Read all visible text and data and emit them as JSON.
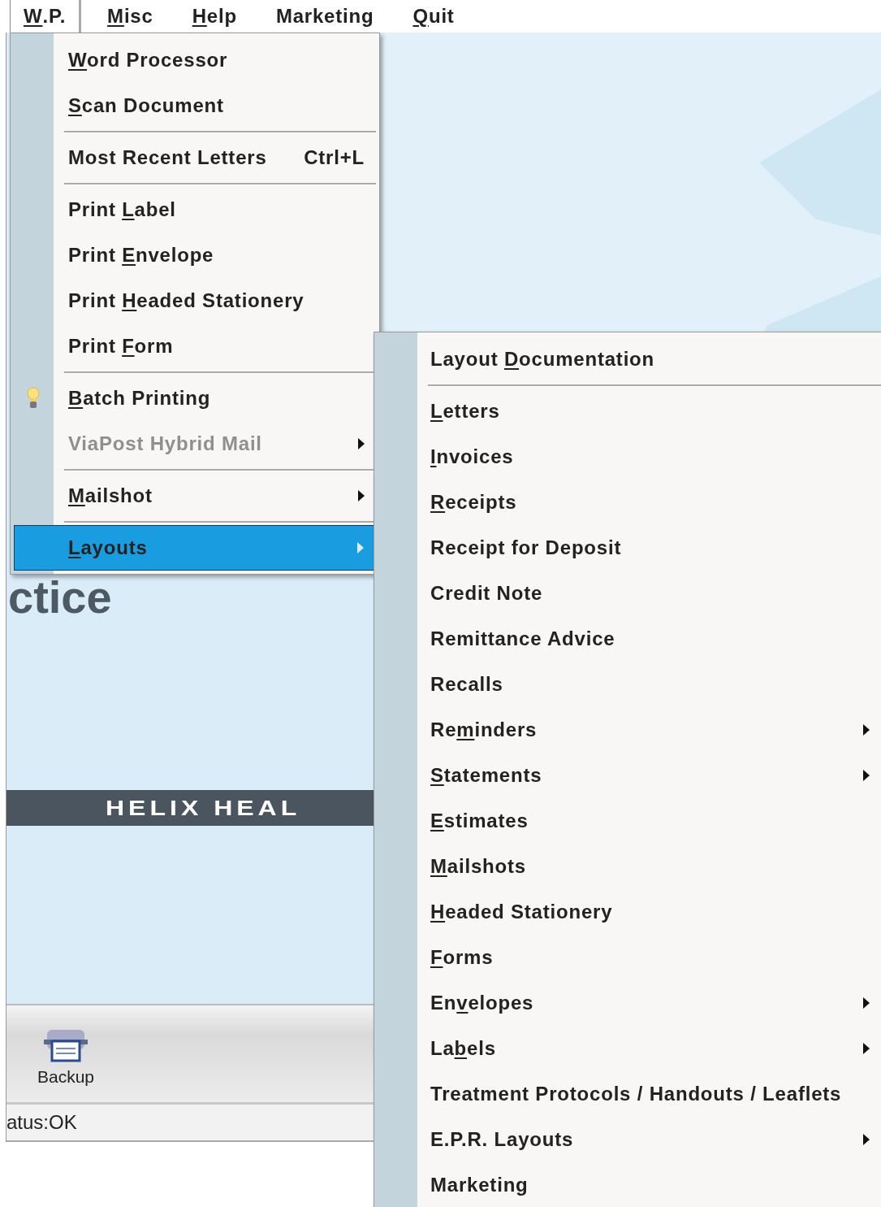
{
  "menubar": [
    {
      "key": "W",
      "after": ".P.",
      "selected": true
    },
    {
      "key": "M",
      "after": "isc",
      "selected": false
    },
    {
      "key": "H",
      "after": "elp",
      "selected": false
    },
    {
      "text": "Marketing",
      "selected": false
    },
    {
      "key": "Q",
      "after": "uit",
      "selected": false
    }
  ],
  "menu": [
    {
      "kind": "command",
      "key": "W",
      "after": "ord Processor",
      "selected": false,
      "disabled": false
    },
    {
      "kind": "command",
      "key": "S",
      "after": "can Document",
      "selected": false,
      "disabled": false
    },
    {
      "kind": "separator"
    },
    {
      "kind": "command",
      "text": "Most Recent Letters",
      "shortcut": "Ctrl+L",
      "selected": false,
      "disabled": false
    },
    {
      "kind": "separator"
    },
    {
      "kind": "command",
      "before": "Print ",
      "key": "L",
      "after": "abel",
      "selected": false,
      "disabled": false
    },
    {
      "kind": "command",
      "before": "Print ",
      "key": "E",
      "after": "nvelope",
      "selected": false,
      "disabled": false
    },
    {
      "kind": "command",
      "before": "Print ",
      "key": "H",
      "after": "eaded Stationery",
      "selected": false,
      "disabled": false
    },
    {
      "kind": "command",
      "before": "Print ",
      "key": "F",
      "after": "orm",
      "selected": false,
      "disabled": false
    },
    {
      "kind": "separator"
    },
    {
      "kind": "icon_command",
      "key": "B",
      "after": "atch Printing",
      "selected": false,
      "disabled": false
    },
    {
      "kind": "submenu",
      "text": "ViaPost Hybrid Mail",
      "selected": false,
      "disabled": true
    },
    {
      "kind": "separator"
    },
    {
      "kind": "submenu",
      "key": "M",
      "after": "ailshot",
      "selected": false,
      "disabled": false
    },
    {
      "kind": "separator"
    },
    {
      "kind": "submenu",
      "key": "L",
      "after": "ayouts",
      "selected": true,
      "disabled": false
    }
  ],
  "submenu": [
    {
      "kind": "command",
      "before": "Layout ",
      "key": "D",
      "after": "ocumentation",
      "selected": false,
      "disabled": false
    },
    {
      "kind": "separator"
    },
    {
      "kind": "command",
      "key": "L",
      "after": "etters",
      "selected": false,
      "disabled": false
    },
    {
      "kind": "command",
      "key": "I",
      "after": "nvoices",
      "selected": false,
      "disabled": false
    },
    {
      "kind": "command",
      "key": "R",
      "after": "eceipts",
      "selected": false,
      "disabled": false
    },
    {
      "kind": "command",
      "text": "Receipt for Deposit",
      "selected": false,
      "disabled": false
    },
    {
      "kind": "command",
      "text": "Credit Note",
      "selected": false,
      "disabled": false
    },
    {
      "kind": "command",
      "text": "Remittance Advice",
      "selected": false,
      "disabled": false
    },
    {
      "kind": "command",
      "text": "Recalls",
      "selected": false,
      "disabled": false
    },
    {
      "kind": "submenu",
      "before": "Re",
      "key": "m",
      "after": "inders",
      "selected": false,
      "disabled": false
    },
    {
      "kind": "submenu",
      "key": "S",
      "after": "tatements",
      "selected": false,
      "disabled": false
    },
    {
      "kind": "command",
      "key": "E",
      "after": "stimates",
      "selected": false,
      "disabled": false
    },
    {
      "kind": "command",
      "key": "M",
      "after": "ailshots",
      "selected": false,
      "disabled": false
    },
    {
      "kind": "command",
      "key": "H",
      "after": "eaded Stationery",
      "selected": false,
      "disabled": false
    },
    {
      "kind": "command",
      "key": "F",
      "after": "orms",
      "selected": false,
      "disabled": false
    },
    {
      "kind": "submenu",
      "before": "En",
      "key": "v",
      "after": "elopes",
      "selected": false,
      "disabled": false
    },
    {
      "kind": "submenu",
      "before": "La",
      "key": "b",
      "after": "els",
      "selected": false,
      "disabled": false
    },
    {
      "kind": "command",
      "text": "Treatment Protocols / Handouts / Leaflets",
      "selected": false,
      "disabled": false
    },
    {
      "kind": "submenu",
      "text": "E.P.R. Layouts",
      "selected": false,
      "disabled": false
    },
    {
      "kind": "command",
      "text": "Marketing",
      "selected": false,
      "disabled": false
    }
  ],
  "app": {
    "logo_text": "ctice",
    "banner_text": "HELIX HEAL",
    "toolbar": [
      {
        "label": "Backup"
      }
    ],
    "status": "atus:OK"
  }
}
